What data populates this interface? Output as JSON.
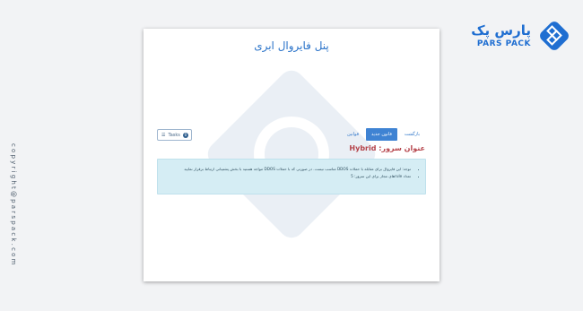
{
  "sidebar": {
    "copyright": "copyright@parspack.com"
  },
  "brand": {
    "name_fa": "پارس پک",
    "name_en": "PARS PACK"
  },
  "panel": {
    "title": "پنل فایروال ابری",
    "tabs": [
      {
        "label": "بازگشت",
        "active": false
      },
      {
        "label": "قانون جدید",
        "active": true
      },
      {
        "label": "قوانین",
        "active": false
      }
    ],
    "tasks_button": {
      "label": "Tasks",
      "count": "0"
    },
    "server": {
      "label": "عنوان سرور:",
      "value": "Hybrid"
    },
    "notice": {
      "items": [
        "توجه: این فایروال برای مقابله با حملات DDOS مناسب نیست. در صورتی که با حملات DDOS مواجه هستید با بخش پشتیبانی ارتباط برقرار نمایید",
        "تعداد rule‌های مجاز برای این سرور: 5"
      ]
    }
  },
  "colors": {
    "accent": "#2a73c9",
    "brand": "#1f6ed1",
    "server_title": "#b5434a",
    "notice_bg": "#d5edf4"
  }
}
